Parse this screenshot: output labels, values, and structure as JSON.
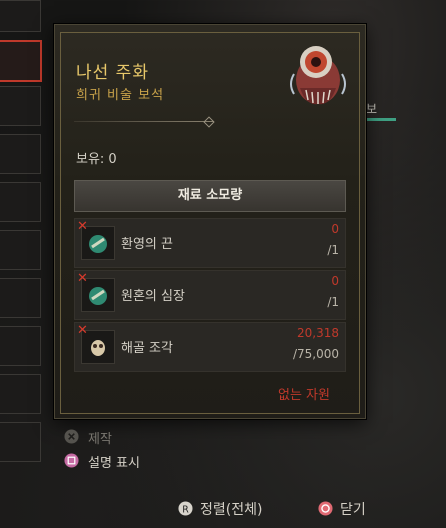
{
  "item": {
    "name": "나선 주화",
    "rarity_type": "희귀 비술 보석",
    "owned_label": "보유: 0"
  },
  "cost": {
    "header": "재료 소모량",
    "materials": [
      {
        "name": "환영의 끈",
        "have": "0",
        "need": "/1"
      },
      {
        "name": "원혼의 심장",
        "have": "0",
        "need": "/1"
      },
      {
        "name": "해골 조각",
        "have": "20,318",
        "need": "/75,000"
      }
    ],
    "insufficient": "없는 자원"
  },
  "hints": {
    "craft": "제작",
    "show_description": "설명 표시"
  },
  "footer": {
    "sort_label": "정렬(전체)",
    "close_label": "닫기"
  },
  "side_label": "보",
  "colors": {
    "title": "#e8c86a",
    "missing": "#c0392b",
    "accent_teal": "#3fa083"
  }
}
